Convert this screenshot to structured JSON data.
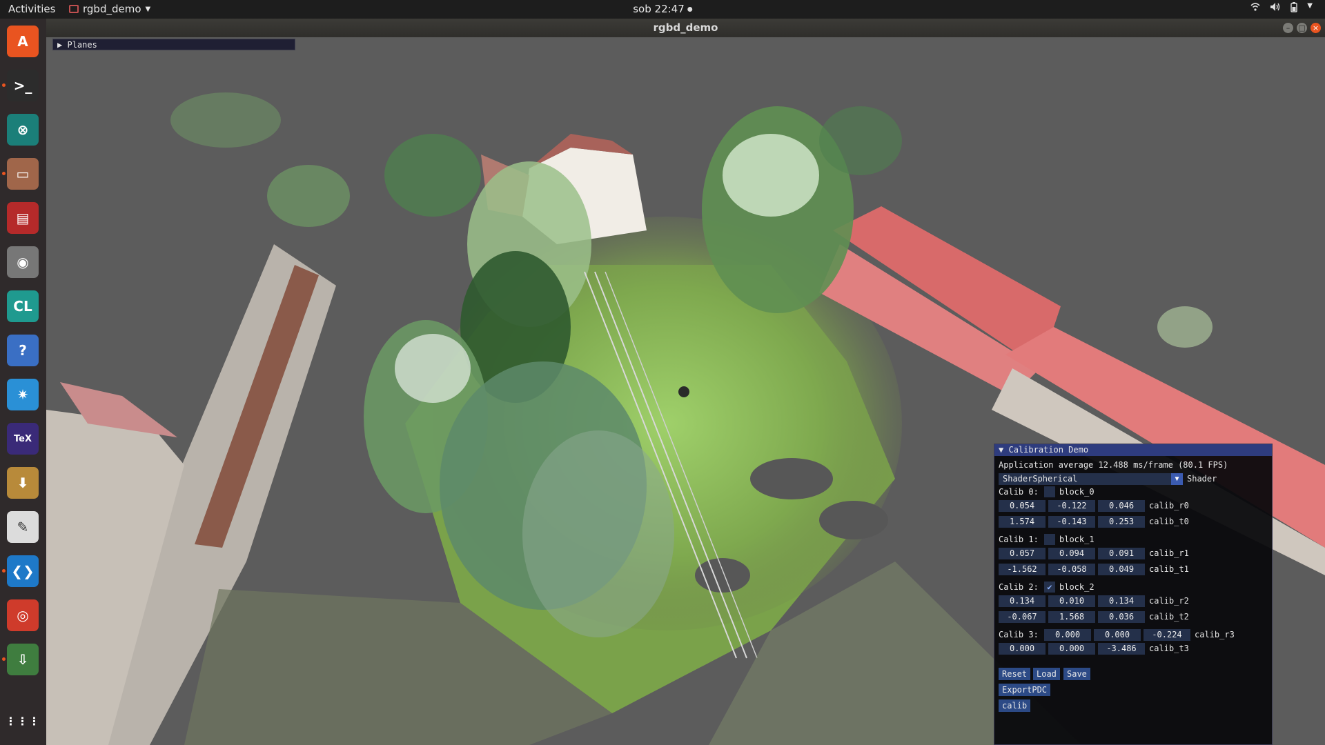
{
  "topbar": {
    "activities": "Activities",
    "app_name": "rgbd_demo",
    "clock": "sob 22:47",
    "tray_icons": [
      "wifi-icon",
      "volume-icon",
      "battery-icon",
      "system-menu-icon"
    ]
  },
  "window": {
    "title": "rgbd_demo"
  },
  "dock": {
    "items": [
      {
        "name": "ubuntu-software",
        "glyph": "A",
        "color": "#e95420"
      },
      {
        "name": "terminal",
        "glyph": ">_",
        "color": "#2c2c2c"
      },
      {
        "name": "gitkraken",
        "glyph": "⊗",
        "color": "#1b7f79"
      },
      {
        "name": "files",
        "glyph": "▭",
        "color": "#a0664a"
      },
      {
        "name": "app-red",
        "glyph": "▤",
        "color": "#b52a2a"
      },
      {
        "name": "eye-app",
        "glyph": "◉",
        "color": "#777"
      },
      {
        "name": "clion",
        "glyph": "CL",
        "color": "#1f9a8f"
      },
      {
        "name": "help",
        "glyph": "?",
        "color": "#3a6fc4"
      },
      {
        "name": "settings-star",
        "glyph": "✷",
        "color": "#2a90d6"
      },
      {
        "name": "texstudio",
        "glyph": "TeX",
        "color": "#3a2a78"
      },
      {
        "name": "archive-manager",
        "glyph": "⬇",
        "color": "#b88a3a"
      },
      {
        "name": "text-editor",
        "glyph": "✎",
        "color": "#dcdcdc"
      },
      {
        "name": "vscode",
        "glyph": "❮❯",
        "color": "#1e79c8"
      },
      {
        "name": "chrome",
        "glyph": "◎",
        "color": "#cf3b2b"
      },
      {
        "name": "installer",
        "glyph": "⇩",
        "color": "#3f7d3f"
      }
    ],
    "show_apps": "⋮⋮⋮"
  },
  "planes": {
    "label": "Planes"
  },
  "calib": {
    "title": "Calibration Demo",
    "fps": "Application average 12.488 ms/frame (80.1 FPS)",
    "shader_value": "ShaderSpherical",
    "shader_label": "Shader",
    "blocks": [
      {
        "label": "Calib 0:",
        "checkbox": "block_0",
        "checked": false,
        "r": [
          "0.054",
          "-0.122",
          "0.046"
        ],
        "r_label": "calib_r0",
        "t": [
          "1.574",
          "-0.143",
          "0.253"
        ],
        "t_label": "calib_t0"
      },
      {
        "label": "Calib 1:",
        "checkbox": "block_1",
        "checked": false,
        "r": [
          "0.057",
          "0.094",
          "0.091"
        ],
        "r_label": "calib_r1",
        "t": [
          "-1.562",
          "-0.058",
          "0.049"
        ],
        "t_label": "calib_t1"
      },
      {
        "label": "Calib 2:",
        "checkbox": "block_2",
        "checked": true,
        "r": [
          "0.134",
          "0.010",
          "0.134"
        ],
        "r_label": "calib_r2",
        "t": [
          "-0.067",
          "1.568",
          "0.036"
        ],
        "t_label": "calib_t2"
      },
      {
        "label": "Calib 3:",
        "checkbox": "",
        "checked": false,
        "r": [
          "0.000",
          "0.000",
          "-0.224"
        ],
        "r_label": "calib_r3",
        "t": [
          "0.000",
          "0.000",
          "-3.486"
        ],
        "t_label": "calib_t3"
      }
    ],
    "buttons": {
      "reset": "Reset",
      "load": "Load",
      "save": "Save",
      "export": "ExportPDC",
      "calib": "calib"
    }
  }
}
